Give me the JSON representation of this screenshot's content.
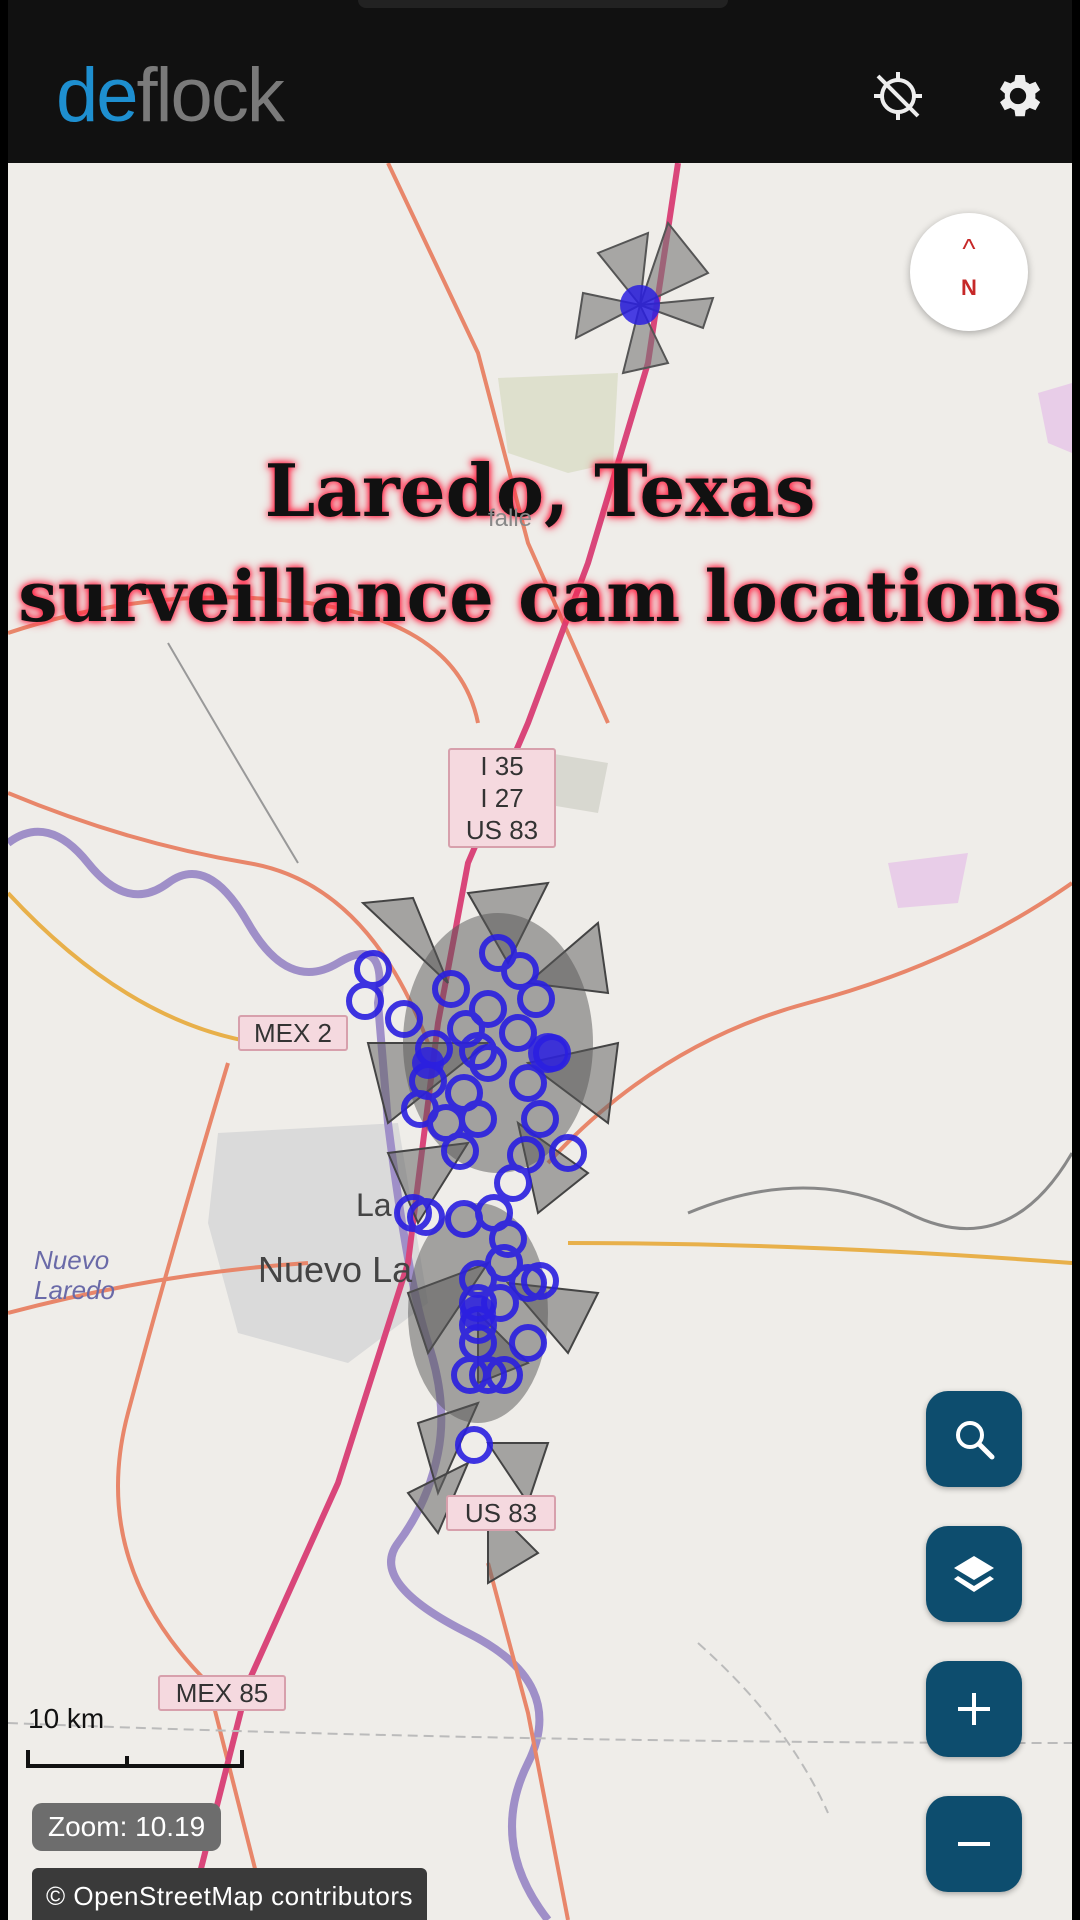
{
  "header": {
    "logo_part1": "de",
    "logo_part2": "flock",
    "tracking_icon": "location-disabled-icon",
    "settings_icon": "gear-icon"
  },
  "overlay_title": {
    "line1": "Laredo, Texas",
    "line2": "surveillance cam locations"
  },
  "map": {
    "road_shields": [
      {
        "id": "i35",
        "lines": [
          "I 35",
          "I 27",
          "US 83"
        ]
      },
      {
        "id": "mex2",
        "lines": [
          "MEX 2"
        ]
      },
      {
        "id": "us83",
        "lines": [
          "US 83"
        ]
      },
      {
        "id": "mex85",
        "lines": [
          "MEX 85"
        ]
      }
    ],
    "places": {
      "nuevo_laredo_small": "Nuevo\nLaredo",
      "nuevo_laredo": "Nuevo La",
      "laredo": "La",
      "faint_label": "falle"
    },
    "compass_letter": "N",
    "scale_label": "10 km",
    "zoom_text": "Zoom: 10.19",
    "attribution": "© OpenStreetMap contributors"
  },
  "controls": {
    "search_icon": "search-icon",
    "layers_icon": "layers-icon",
    "zoom_in_icon": "plus-icon",
    "zoom_out_icon": "minus-icon"
  },
  "colors": {
    "topbar": "#111111",
    "brand_blue": "#1e8fd0",
    "fab": "#0d4d6e",
    "camera_marker": "#2a1fe0",
    "title_glow": "#ff1a3c"
  }
}
